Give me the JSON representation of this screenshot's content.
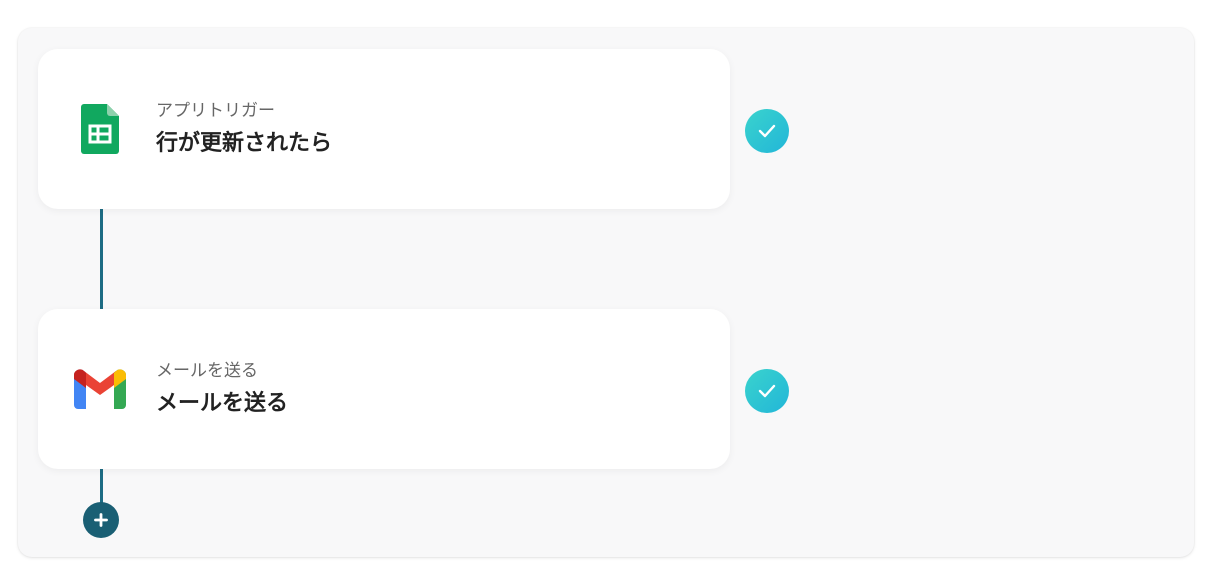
{
  "flow": {
    "steps": [
      {
        "subtitle": "アプリトリガー",
        "title": "行が更新されたら",
        "app_icon": "google-sheets-icon",
        "status_icon": "check-icon",
        "status": "completed"
      },
      {
        "subtitle": "メールを送る",
        "title": "メールを送る",
        "app_icon": "gmail-icon",
        "status_icon": "check-icon",
        "status": "completed"
      }
    ],
    "add_button_icon": "plus-icon"
  },
  "colors": {
    "connector": "#1d6c84",
    "check_gradient_start": "#3ad3cd",
    "check_gradient_end": "#22b6d8",
    "add_button": "#1a5f74",
    "panel_background": "#f8f8f9"
  }
}
